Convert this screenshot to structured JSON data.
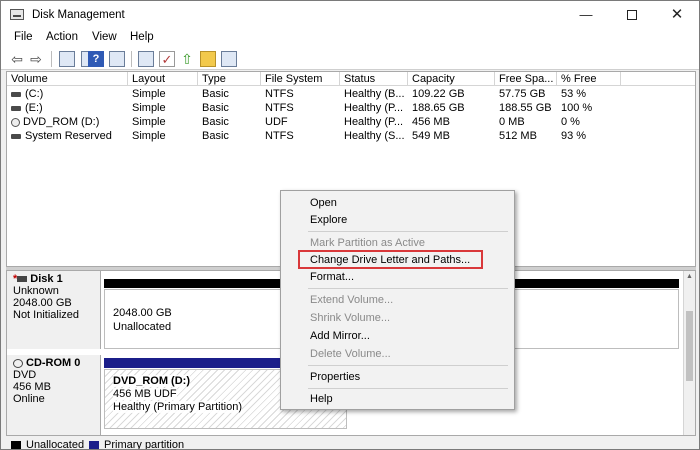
{
  "window": {
    "title": "Disk Management",
    "controls": {
      "minimize": "—",
      "close": "✕"
    }
  },
  "menu": {
    "file": "File",
    "action": "Action",
    "view": "View",
    "help": "Help"
  },
  "toolbar": {
    "help_glyph": "?",
    "back_glyph": "⇦",
    "forward_glyph": "⇨",
    "up_glyph": "⇧",
    "check_glyph": "✓"
  },
  "volume_list": {
    "headers": {
      "volume": "Volume",
      "layout": "Layout",
      "type": "Type",
      "fs": "File System",
      "status": "Status",
      "capacity": "Capacity",
      "free": "Free Spa...",
      "pct": "% Free"
    },
    "rows": [
      {
        "volume": "(C:)",
        "layout": "Simple",
        "type": "Basic",
        "fs": "NTFS",
        "status": "Healthy (B...",
        "capacity": "109.22 GB",
        "free": "57.75 GB",
        "pct": "53 %"
      },
      {
        "volume": "(E:)",
        "layout": "Simple",
        "type": "Basic",
        "fs": "NTFS",
        "status": "Healthy (P...",
        "capacity": "188.65 GB",
        "free": "188.55 GB",
        "pct": "100 %"
      },
      {
        "volume": "DVD_ROM (D:)",
        "layout": "Simple",
        "type": "Basic",
        "fs": "UDF",
        "status": "Healthy (P...",
        "capacity": "456 MB",
        "free": "0 MB",
        "pct": "0 %"
      },
      {
        "volume": "System Reserved",
        "layout": "Simple",
        "type": "Basic",
        "fs": "NTFS",
        "status": "Healthy (S...",
        "capacity": "549 MB",
        "free": "512 MB",
        "pct": "93 %"
      }
    ]
  },
  "disks": {
    "disk1": {
      "name": "Disk 1",
      "error_mark": "*",
      "kind": "Unknown",
      "size": "2048.00 GB",
      "state": "Not Initialized",
      "partition": {
        "size": "2048.00 GB",
        "label": "Unallocated"
      }
    },
    "cdrom0": {
      "name": "CD-ROM 0",
      "kind": "DVD",
      "size": "456 MB",
      "state": "Online",
      "partition": {
        "name": "DVD_ROM  (D:)",
        "fs": "456 MB UDF",
        "health": "Healthy (Primary Partition)"
      }
    }
  },
  "legend": {
    "unallocated": "Unallocated",
    "primary": "Primary partition"
  },
  "context_menu": {
    "open": "Open",
    "explore": "Explore",
    "mark_active": "Mark Partition as Active",
    "change_letter": "Change Drive Letter and Paths...",
    "format": "Format...",
    "extend": "Extend Volume...",
    "shrink": "Shrink Volume...",
    "add_mirror": "Add Mirror...",
    "delete": "Delete Volume...",
    "properties": "Properties",
    "help": "Help"
  },
  "colors": {
    "highlight_box": "#d9383a",
    "primary_partition": "#1b1e8a",
    "unallocated": "#000000"
  }
}
